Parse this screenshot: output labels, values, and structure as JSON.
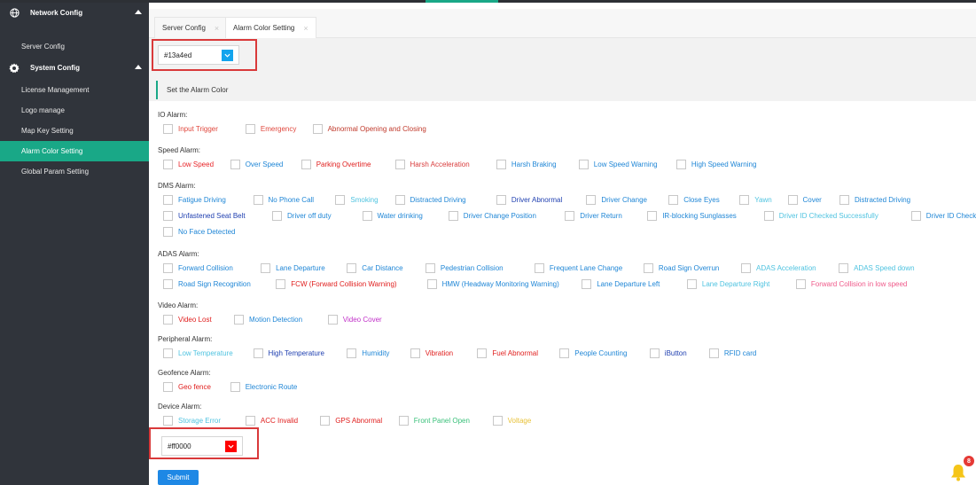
{
  "sidebar": {
    "items": [
      {
        "label": "Network Config",
        "kind": "group",
        "icon": "globe-icon"
      },
      {
        "label": "Server Config",
        "kind": "sub"
      },
      {
        "label": "System Config",
        "kind": "group",
        "icon": "gear-icon"
      },
      {
        "label": "License Management",
        "kind": "sub"
      },
      {
        "label": "Logo manage",
        "kind": "sub"
      },
      {
        "label": "Map Key Setting",
        "kind": "sub"
      },
      {
        "label": "Alarm Color Setting",
        "kind": "sub",
        "active": true
      },
      {
        "label": "Global Param Setting",
        "kind": "sub"
      }
    ]
  },
  "tabs": [
    {
      "label": "Server Config",
      "close": "×"
    },
    {
      "label": "Alarm Color Setting",
      "close": "×",
      "active": true
    }
  ],
  "top_color": {
    "value": "#13a4ed",
    "swatch": "#13a4ed"
  },
  "bottom_color": {
    "value": "#ff0000",
    "swatch": "#ff0000"
  },
  "section_title": "Set the Alarm Color",
  "groups": [
    {
      "title": "IO Alarm:",
      "rows": [
        [
          {
            "label": "Input Trigger",
            "color": "#e0473d"
          },
          {
            "label": "Emergency",
            "color": "#e0473d"
          },
          {
            "label": "Abnormal Opening and Closing",
            "color": "#c0392b"
          }
        ]
      ]
    },
    {
      "title": "Speed Alarm:",
      "rows": [
        [
          {
            "label": "Low Speed",
            "color": "#e8262a"
          },
          {
            "label": "Over Speed",
            "color": "#1f86d6"
          },
          {
            "label": "Parking Overtime",
            "color": "#e0201f"
          },
          {
            "label": "Harsh Acceleration",
            "color": "#d93c3c"
          },
          {
            "label": "Harsh Braking",
            "color": "#1f86d6"
          },
          {
            "label": "Low Speed Warning",
            "color": "#1f86d6"
          },
          {
            "label": "High Speed Warning",
            "color": "#1f86d6"
          }
        ]
      ]
    },
    {
      "title": "DMS Alarm:",
      "rows": [
        [
          {
            "label": "Fatigue Driving",
            "color": "#1f86d6"
          },
          {
            "label": "No Phone Call",
            "color": "#1f86d6"
          },
          {
            "label": "Smoking",
            "color": "#4fc3e0"
          },
          {
            "label": "Distracted Driving",
            "color": "#1f86d6"
          },
          {
            "label": "Driver Abnormal",
            "color": "#1f3fb0"
          },
          {
            "label": "Driver Change",
            "color": "#1f86d6"
          },
          {
            "label": "Close Eyes",
            "color": "#1f86d6"
          },
          {
            "label": "Yawn",
            "color": "#4fc3e0"
          },
          {
            "label": "Cover",
            "color": "#1f86d6"
          },
          {
            "label": "Distracted Driving",
            "color": "#1f86d6"
          }
        ],
        [
          {
            "label": "Unfastened Seat Belt",
            "color": "#1f3fb0"
          },
          {
            "label": "Driver off duty",
            "color": "#1f86d6"
          },
          {
            "label": "Water drinking",
            "color": "#1f86d6"
          },
          {
            "label": "Driver Change Position",
            "color": "#1f86d6"
          },
          {
            "label": "Driver Return",
            "color": "#1f86d6"
          },
          {
            "label": "IR-blocking Sunglasses",
            "color": "#1f86d6"
          },
          {
            "label": "Driver ID Checked Successfully",
            "color": "#4fc3e0"
          },
          {
            "label": "Driver ID Checking Failed",
            "color": "#1f86d6"
          }
        ],
        [
          {
            "label": "No Face Detected",
            "color": "#1f86d6"
          }
        ]
      ]
    },
    {
      "title": "ADAS Alarm:",
      "rows": [
        [
          {
            "label": "Forward Collision",
            "color": "#1f86d6"
          },
          {
            "label": "Lane Departure",
            "color": "#1f86d6"
          },
          {
            "label": "Car Distance",
            "color": "#1f86d6"
          },
          {
            "label": "Pedestrian Collision",
            "color": "#1f86d6"
          },
          {
            "label": "Frequent Lane Change",
            "color": "#1f86d6"
          },
          {
            "label": "Road Sign Overrun",
            "color": "#1f86d6"
          },
          {
            "label": "ADAS Acceleration",
            "color": "#4fc3e0"
          },
          {
            "label": "ADAS Speed down",
            "color": "#4fc3e0"
          }
        ],
        [
          {
            "label": "Road Sign Recognition",
            "color": "#1f86d6"
          },
          {
            "label": "FCW (Forward Collision Warning)",
            "color": "#e0201f"
          },
          {
            "label": "HMW (Headway Monitoring Warning)",
            "color": "#1f86d6"
          },
          {
            "label": "Lane Departure Left",
            "color": "#1f86d6"
          },
          {
            "label": "Lane Departure Right",
            "color": "#4fc3e0"
          },
          {
            "label": "Forward Collision in low speed",
            "color": "#ef5a8a"
          }
        ]
      ]
    },
    {
      "title": "Video Alarm:",
      "rows": [
        [
          {
            "label": "Video Lost",
            "color": "#e0201f"
          },
          {
            "label": "Motion Detection",
            "color": "#1f86d6"
          },
          {
            "label": "Video Cover",
            "color": "#c030c8"
          }
        ]
      ]
    },
    {
      "title": "Peripheral Alarm:",
      "rows": [
        [
          {
            "label": "Low Temperature",
            "color": "#4fc3e0"
          },
          {
            "label": "High Temperature",
            "color": "#1f3fb0"
          },
          {
            "label": "Humidity",
            "color": "#1f86d6"
          },
          {
            "label": "Vibration",
            "color": "#e0201f"
          },
          {
            "label": "Fuel Abnormal",
            "color": "#e0201f"
          },
          {
            "label": "People Counting",
            "color": "#1f86d6"
          },
          {
            "label": "iButton",
            "color": "#1f3fb0"
          },
          {
            "label": "RFID card",
            "color": "#1f86d6"
          }
        ]
      ]
    },
    {
      "title": "Geofence Alarm:",
      "rows": [
        [
          {
            "label": "Geo fence",
            "color": "#e0201f"
          },
          {
            "label": "Electronic Route",
            "color": "#1f86d6"
          }
        ]
      ]
    },
    {
      "title": "Device Alarm:",
      "rows": [
        [
          {
            "label": "Storage Error",
            "color": "#4fc3e0"
          },
          {
            "label": "ACC Invalid",
            "color": "#e0201f"
          },
          {
            "label": "GPS Abnormal",
            "color": "#e0201f"
          },
          {
            "label": "Front Panel Open",
            "color": "#3ac07a"
          },
          {
            "label": "Voltage",
            "color": "#e8c23a"
          }
        ]
      ]
    }
  ],
  "submit_label": "Submit",
  "notification_count": "8"
}
